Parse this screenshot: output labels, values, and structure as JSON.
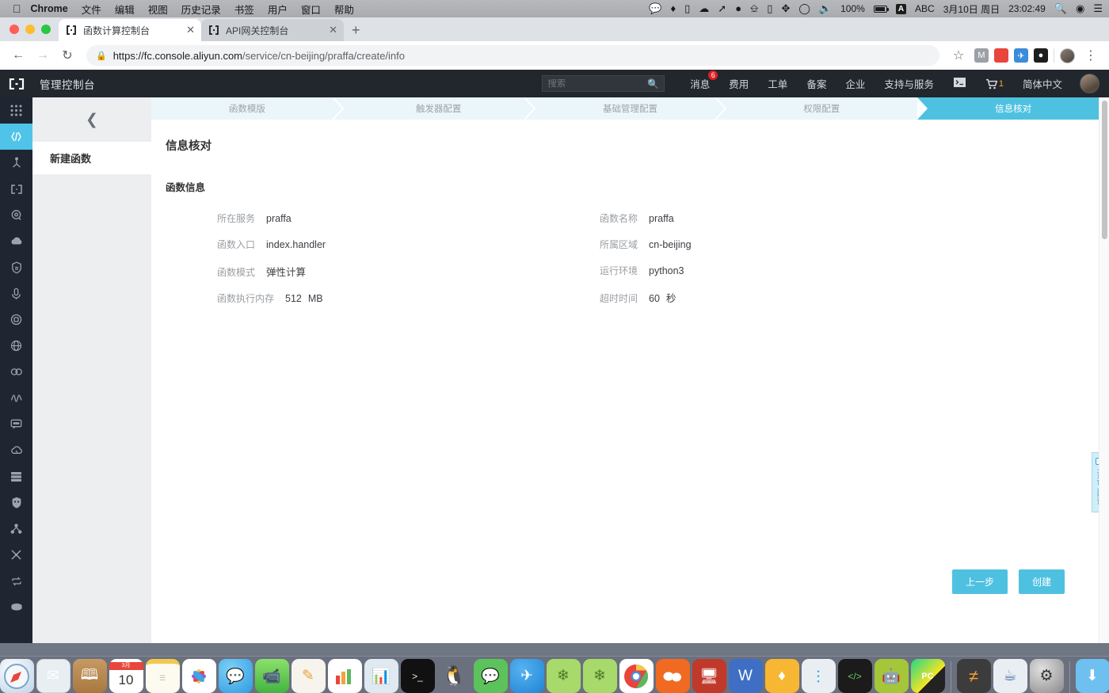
{
  "menubar": {
    "apple": "",
    "items": [
      "Chrome",
      "文件",
      "编辑",
      "视图",
      "历史记录",
      "书签",
      "用户",
      "窗口",
      "帮助"
    ],
    "status": {
      "battery_percent": "100%",
      "input_source": "A",
      "input_label": "ABC",
      "date": "3月10日 周日",
      "time": "23:02:49"
    }
  },
  "browser": {
    "tabs": [
      {
        "title": "函数计算控制台",
        "active": true
      },
      {
        "title": "API网关控制台",
        "active": false
      }
    ],
    "new_tab_label": "+",
    "url_secure": "https://fc.console.aliyun.com",
    "url_path": "/service/cn-beijing/praffa/create/info",
    "url_full": "https://fc.console.aliyun.com/service/cn-beijing/praffa/create/info"
  },
  "ali_header": {
    "title": "管理控制台",
    "search_placeholder": "搜索",
    "nav": [
      {
        "label": "消息",
        "badge": "6"
      },
      {
        "label": "费用",
        "badge": ""
      },
      {
        "label": "工单",
        "badge": ""
      },
      {
        "label": "备案",
        "badge": ""
      },
      {
        "label": "企业",
        "badge": ""
      },
      {
        "label": "支持与服务",
        "badge": ""
      }
    ],
    "cart_count": "1",
    "language": "简体中文"
  },
  "subnav": {
    "entry": "新建函数"
  },
  "steps": [
    {
      "label": "函数模版",
      "active": false
    },
    {
      "label": "触发器配置",
      "active": false
    },
    {
      "label": "基础管理配置",
      "active": false
    },
    {
      "label": "权限配置",
      "active": false
    },
    {
      "label": "信息核对",
      "active": true
    }
  ],
  "main": {
    "page_title": "信息核对",
    "section_title": "函数信息",
    "left_rows": [
      {
        "label": "所在服务",
        "value": "praffa",
        "unit": ""
      },
      {
        "label": "函数入口",
        "value": "index.handler",
        "unit": ""
      },
      {
        "label": "函数模式",
        "value": "弹性计算",
        "unit": ""
      },
      {
        "label": "函数执行内存",
        "value": "512",
        "unit": "MB"
      }
    ],
    "right_rows": [
      {
        "label": "函数名称",
        "value": "praffa",
        "unit": ""
      },
      {
        "label": "所属区域",
        "value": "cn-beijing",
        "unit": ""
      },
      {
        "label": "运行环境",
        "value": "python3",
        "unit": ""
      },
      {
        "label": "超时时间",
        "value": "60",
        "unit": "秒"
      }
    ],
    "buttons": {
      "prev": "上一步",
      "create": "创建"
    }
  },
  "feedback": {
    "text": "咨询·建议"
  },
  "colors": {
    "accent": "#4fc1e0",
    "step_bg": "#eaf6fa",
    "header_bg": "#22262d",
    "rail_bg": "#1f2632",
    "badge_red": "#e02020",
    "cart_orange": "#f5a623"
  }
}
